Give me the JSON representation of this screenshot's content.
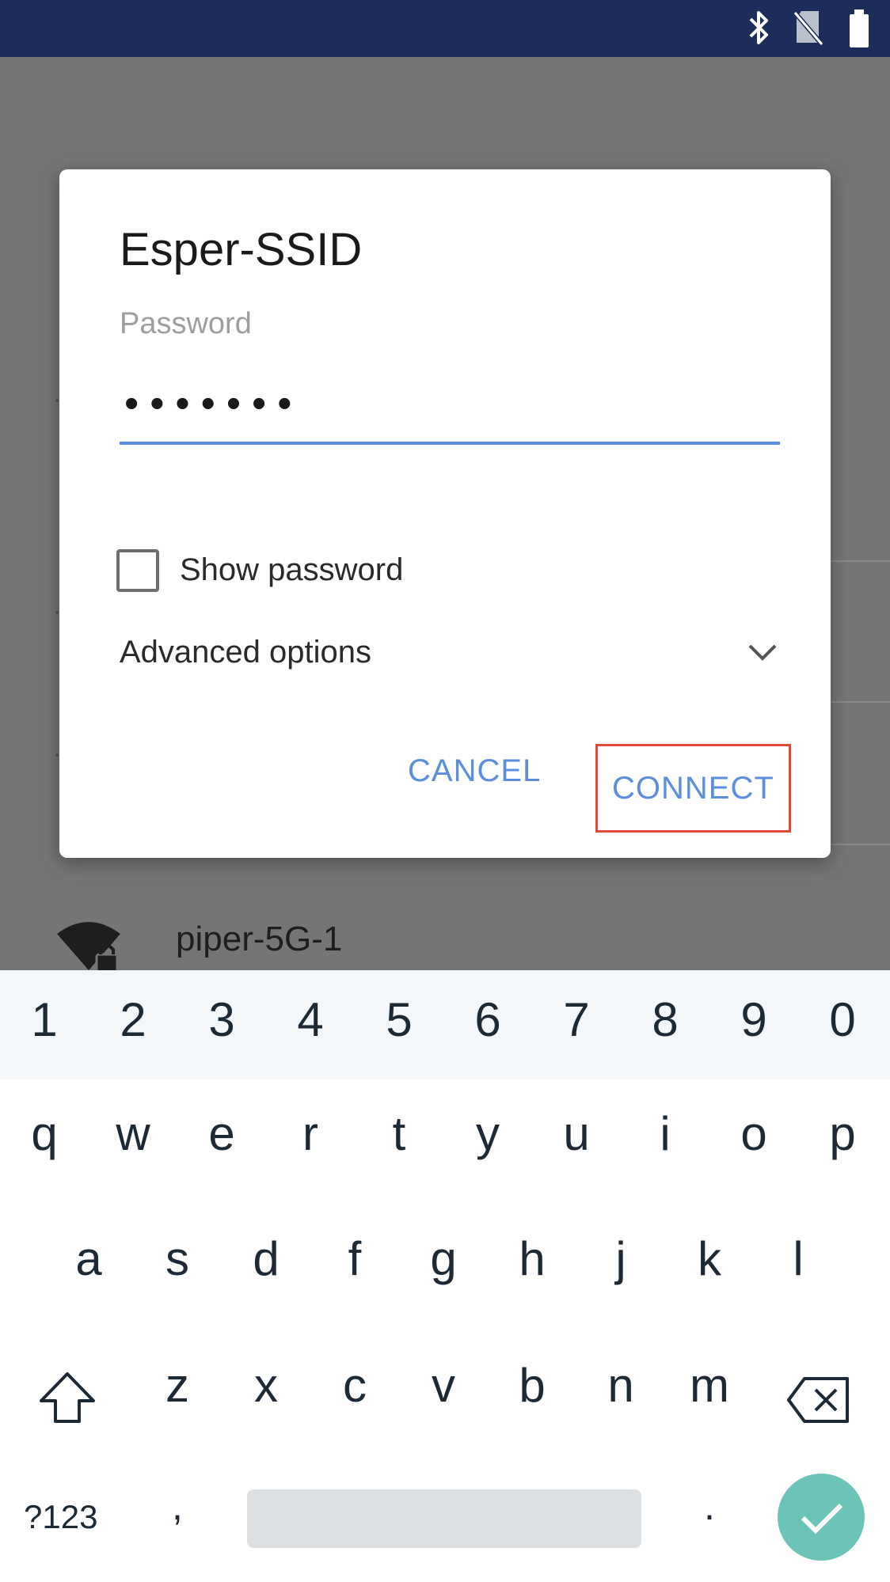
{
  "status_bar": {
    "icons": [
      "bluetooth-icon",
      "no-sim-icon",
      "battery-icon"
    ],
    "background": "#1b2d58"
  },
  "background_screen": {
    "network_name": "piper-5G-1",
    "network_icon": "wifi-lock-icon"
  },
  "dialog": {
    "title": "Esper-SSID",
    "password_label": "Password",
    "password_value": "•••••••",
    "show_password_label": "Show password",
    "show_password_checked": false,
    "advanced_options_label": "Advanced options",
    "cancel_label": "CANCEL",
    "connect_label": "CONNECT",
    "accent_color": "#5b8fdd",
    "highlight_color": "#e04a33"
  },
  "keyboard": {
    "number_row": [
      "1",
      "2",
      "3",
      "4",
      "5",
      "6",
      "7",
      "8",
      "9",
      "0"
    ],
    "row1": [
      "q",
      "w",
      "e",
      "r",
      "t",
      "y",
      "u",
      "i",
      "o",
      "p"
    ],
    "row2": [
      "a",
      "s",
      "d",
      "f",
      "g",
      "h",
      "j",
      "k",
      "l"
    ],
    "row3": [
      "z",
      "x",
      "c",
      "v",
      "b",
      "n",
      "m"
    ],
    "symbols_label": "?123",
    "comma": ",",
    "period": ".",
    "enter_color": "#6cc4b8"
  }
}
